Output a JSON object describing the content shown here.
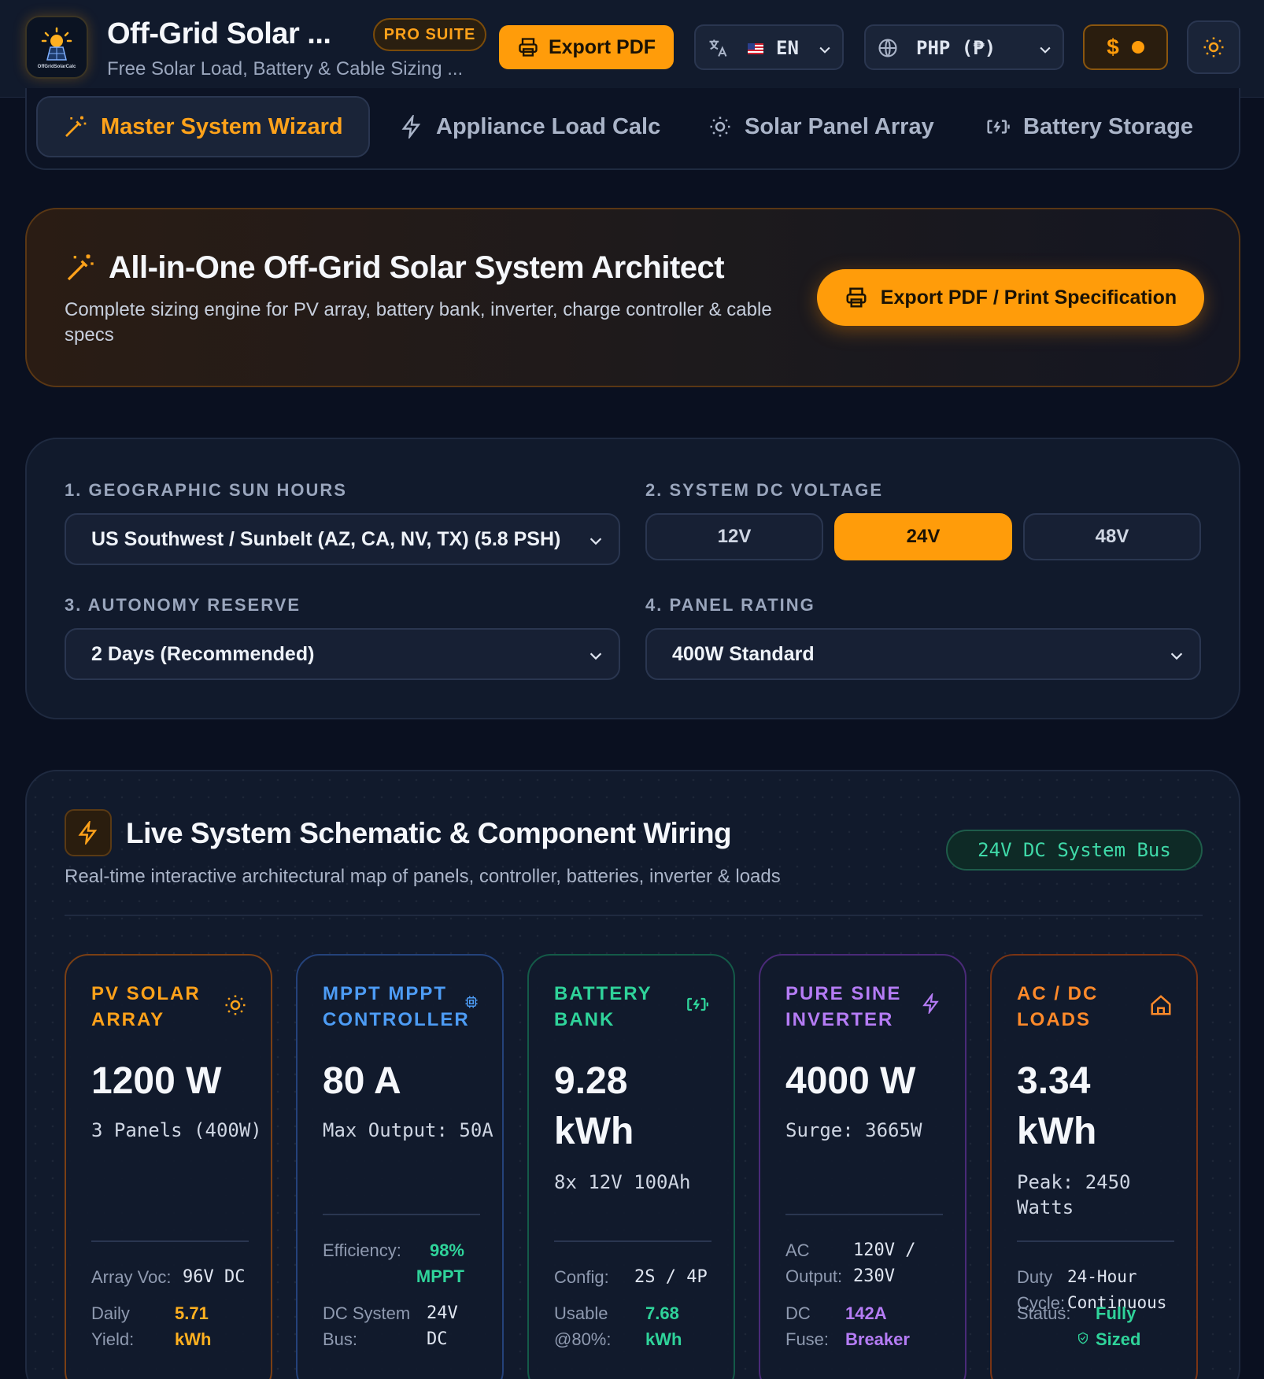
{
  "header": {
    "app_title": "Off-Grid Solar ...",
    "app_subtitle": "Free Solar Load, Battery & Cable Sizing ...",
    "logo_text": "OffGridSolarCalc",
    "pro_badge": "PRO SUITE",
    "export_label": "Export PDF",
    "language": "EN",
    "currency": "PHP (₱)",
    "currency_symbol": "$"
  },
  "tabs": [
    {
      "label": "Master System Wizard",
      "icon": "magic-wand-icon",
      "active": true
    },
    {
      "label": "Appliance Load Calc",
      "icon": "lightning-icon",
      "active": false
    },
    {
      "label": "Solar Panel Array",
      "icon": "sun-icon",
      "active": false
    },
    {
      "label": "Battery Storage",
      "icon": "battery-charging-icon",
      "active": false
    }
  ],
  "hero": {
    "title": "All-in-One Off-Grid Solar System Architect",
    "description": "Complete sizing engine for PV array, battery bank, inverter, charge controller & cable specs",
    "button_label": "Export PDF / Print Specification"
  },
  "config": {
    "sun_hours_label": "1. GEOGRAPHIC SUN HOURS",
    "sun_hours_value": "US Southwest / Sunbelt (AZ, CA, NV, TX) (5.8 PSH)",
    "voltage_label": "2. SYSTEM DC VOLTAGE",
    "voltages": [
      "12V",
      "24V",
      "48V"
    ],
    "selected_voltage": "24V",
    "autonomy_label": "3. AUTONOMY RESERVE",
    "autonomy_value": "2 Days (Recommended)",
    "panel_label": "4. PANEL RATING",
    "panel_value": "400W Standard"
  },
  "schematic": {
    "title": "Live System Schematic & Component Wiring",
    "description": "Real-time interactive architectural map of panels, controller, batteries, inverter & loads",
    "bus_badge": "24V DC System Bus",
    "cards": {
      "pv": {
        "head": "PV SOLAR ARRAY",
        "value": "1200 W",
        "sub": "3 Panels (400W)",
        "rows": [
          {
            "label": "Array Voc:",
            "value": "96V DC"
          },
          {
            "label": "Daily Yield:",
            "value": "5.71 kWh"
          }
        ]
      },
      "mppt": {
        "head": "MPPT MPPT CONTROLLER",
        "value": "80 A",
        "sub": "Max Output: 50A",
        "rows": [
          {
            "label": "Efficiency:",
            "value": "98% MPPT"
          },
          {
            "label": "DC System Bus:",
            "value": "24V DC"
          }
        ]
      },
      "battery": {
        "head": "BATTERY BANK",
        "value": "9.28 kWh",
        "sub": "8x 12V 100Ah",
        "rows": [
          {
            "label": "Config:",
            "value": "2S / 4P"
          },
          {
            "label": "Usable @80%:",
            "value": "7.68 kWh"
          }
        ]
      },
      "inverter": {
        "head": "PURE SINE INVERTER",
        "value": "4000 W",
        "sub": "Surge: 3665W",
        "rows": [
          {
            "label": "AC Output:",
            "value": "120V / 230V"
          },
          {
            "label": "DC Fuse:",
            "value": "142A Breaker"
          }
        ]
      },
      "loads": {
        "head": "AC / DC LOADS",
        "value": "3.34 kWh",
        "sub": "Peak: 2450 Watts",
        "rows": [
          {
            "label": "Duty Cycle:",
            "value": "24-Hour Continuous"
          },
          {
            "label": "Status:",
            "value": "Fully Sized"
          }
        ]
      }
    }
  },
  "colors": {
    "accent": "#ff9c0a",
    "pv": "#ffa21a",
    "mppt": "#4d9cf5",
    "battery": "#2fd39a",
    "inverter": "#b57cf5",
    "loads": "#ff8a2a"
  }
}
